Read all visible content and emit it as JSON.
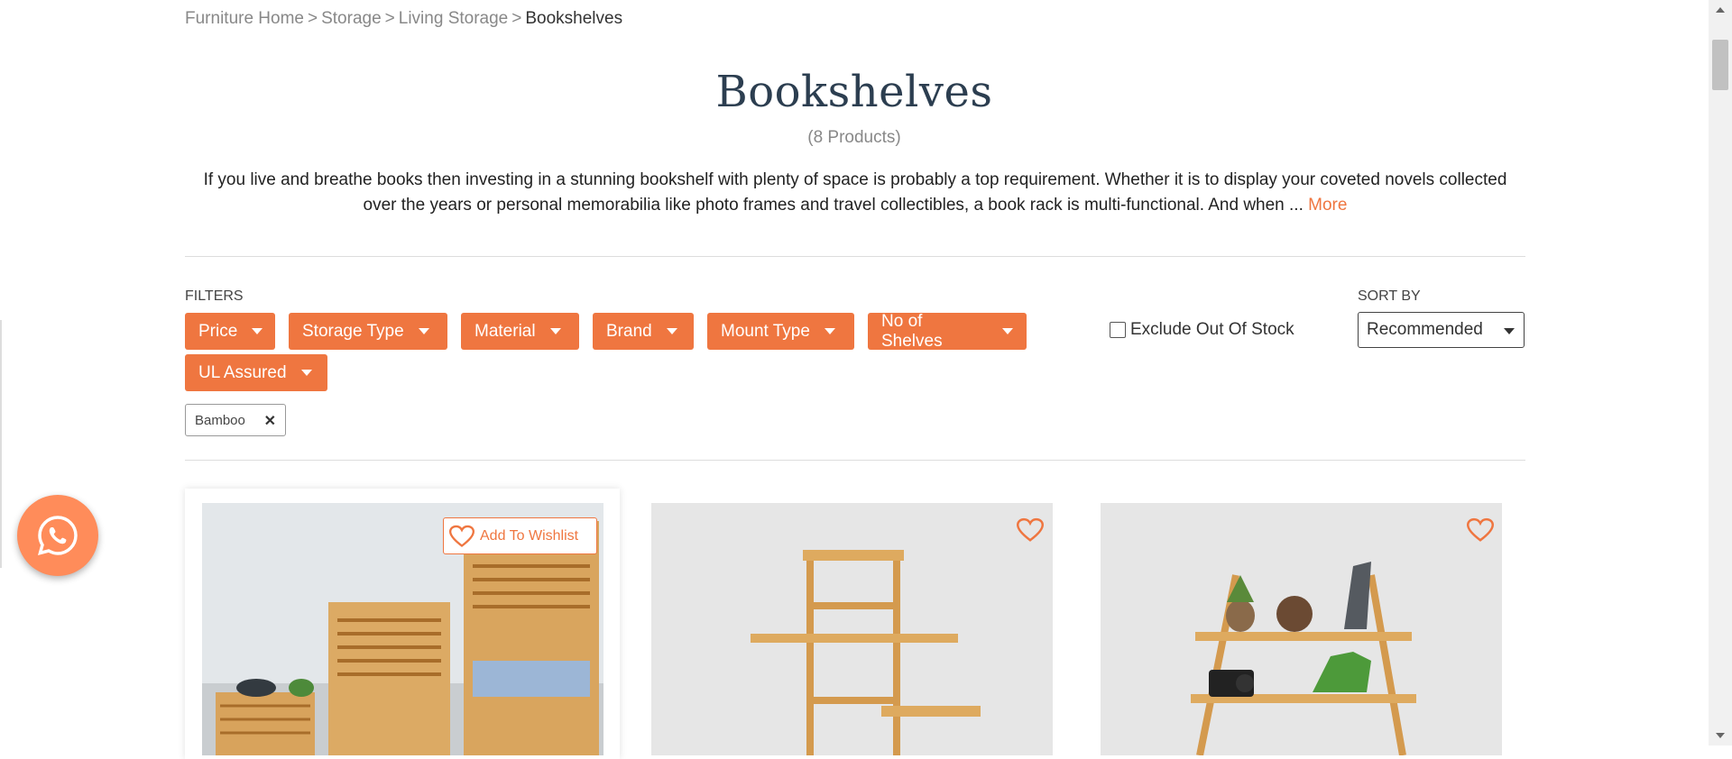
{
  "breadcrumb": {
    "items": [
      "Furniture Home",
      "Storage",
      "Living Storage"
    ],
    "separator": ">",
    "current": "Bookshelves"
  },
  "page": {
    "title": "Bookshelves",
    "count": "(8 Products)",
    "description": "If you live and breathe books then investing in a stunning bookshelf with plenty of space is probably a top requirement. Whether it is to display your coveted novels collected over the years or personal memorabilia like photo frames and travel collectibles, a book rack is multi-functional. And when ... ",
    "more_label": "More"
  },
  "filters": {
    "label": "FILTERS",
    "buttons": [
      "Price",
      "Storage Type",
      "Material",
      "Brand",
      "Mount Type",
      "No of Shelves",
      "UL Assured"
    ],
    "exclude_label": "Exclude Out Of Stock",
    "exclude_checked": false,
    "active_chip": "Bamboo"
  },
  "sort": {
    "label": "SORT BY",
    "value": "Recommended"
  },
  "products": {
    "wishlist_label": "Add To Wishlist"
  },
  "icons": {
    "whatsapp": "whatsapp-icon",
    "heart": "heart-icon",
    "close": "close-icon"
  },
  "colors": {
    "accent": "#ef7640",
    "title": "#2c3e50",
    "whatsapp_bg": "#ff8c5a"
  }
}
